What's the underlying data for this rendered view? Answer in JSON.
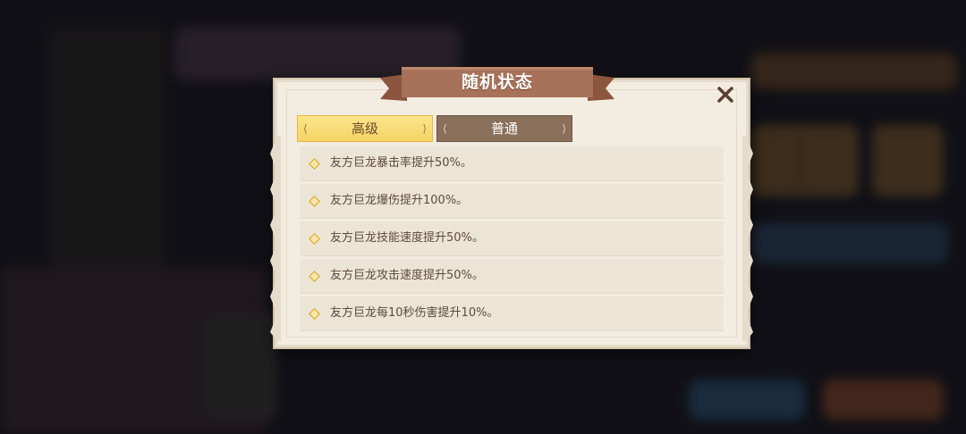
{
  "dialog": {
    "title": "随机状态",
    "tabs": [
      {
        "label": "高级",
        "active": true
      },
      {
        "label": "普通",
        "active": false
      }
    ],
    "effects": [
      "友方巨龙暴击率提升50%。",
      "友方巨龙爆伤提升100%。",
      "友方巨龙技能速度提升50%。",
      "友方巨龙攻击速度提升50%。",
      "友方巨龙每10秒伤害提升10%。"
    ],
    "close_icon": "close-x-icon",
    "bullet_icon": "diamond-bullet-icon"
  },
  "colors": {
    "panel": "#f3ede1",
    "ribbon": "#a8725a",
    "tab_active": "#f6d465",
    "tab_inactive": "#8a6f5a",
    "text": "#5d4a3c",
    "bullet": "#d9a21f"
  }
}
